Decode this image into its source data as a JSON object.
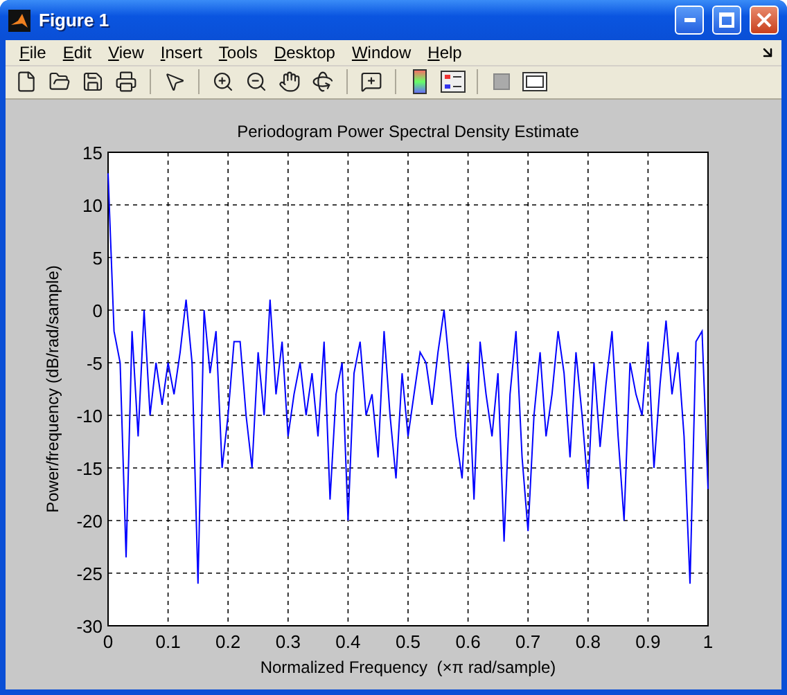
{
  "window": {
    "title": "Figure 1"
  },
  "menu": [
    "File",
    "Edit",
    "View",
    "Insert",
    "Tools",
    "Desktop",
    "Window",
    "Help"
  ],
  "toolbar": [
    {
      "kind": "new"
    },
    {
      "kind": "open"
    },
    {
      "kind": "save"
    },
    {
      "kind": "print"
    },
    {
      "kind": "sep"
    },
    {
      "kind": "pointer"
    },
    {
      "kind": "sep"
    },
    {
      "kind": "zoomin"
    },
    {
      "kind": "zoomout"
    },
    {
      "kind": "pan"
    },
    {
      "kind": "rotate"
    },
    {
      "kind": "sep"
    },
    {
      "kind": "datacursor"
    },
    {
      "kind": "sep"
    },
    {
      "kind": "colorbar"
    },
    {
      "kind": "legend"
    },
    {
      "kind": "sep"
    },
    {
      "kind": "hidetools"
    },
    {
      "kind": "showtools"
    }
  ],
  "figure": {
    "chart_data": {
      "type": "line",
      "title": "Periodogram Power Spectral Density Estimate",
      "xlabel": "Normalized Frequency  (×π rad/sample)",
      "ylabel": "Power/frequency (dB/rad/sample)",
      "grid": true,
      "xlim": [
        0,
        1
      ],
      "ylim": [
        -30,
        15
      ],
      "xticks": [
        0,
        0.1,
        0.2,
        0.3,
        0.4,
        0.5,
        0.6,
        0.7,
        0.8,
        0.9,
        1
      ],
      "yticks": [
        -30,
        -25,
        -20,
        -15,
        -10,
        -5,
        0,
        5,
        10,
        15
      ],
      "x": [
        0,
        0.01,
        0.02,
        0.03,
        0.04,
        0.05,
        0.06,
        0.07,
        0.08,
        0.09,
        0.1,
        0.11,
        0.12,
        0.13,
        0.14,
        0.15,
        0.16,
        0.17,
        0.18,
        0.19,
        0.2,
        0.21,
        0.22,
        0.23,
        0.24,
        0.25,
        0.26,
        0.27,
        0.28,
        0.29,
        0.3,
        0.31,
        0.32,
        0.33,
        0.34,
        0.35,
        0.36,
        0.37,
        0.38,
        0.39,
        0.4,
        0.41,
        0.42,
        0.43,
        0.44,
        0.45,
        0.46,
        0.47,
        0.48,
        0.49,
        0.5,
        0.51,
        0.52,
        0.53,
        0.54,
        0.55,
        0.56,
        0.57,
        0.58,
        0.59,
        0.6,
        0.61,
        0.62,
        0.63,
        0.64,
        0.65,
        0.66,
        0.67,
        0.68,
        0.69,
        0.7,
        0.71,
        0.72,
        0.73,
        0.74,
        0.75,
        0.76,
        0.77,
        0.78,
        0.79,
        0.8,
        0.81,
        0.82,
        0.83,
        0.84,
        0.85,
        0.86,
        0.87,
        0.88,
        0.89,
        0.9,
        0.91,
        0.92,
        0.93,
        0.94,
        0.95,
        0.96,
        0.97,
        0.98,
        0.99,
        1
      ],
      "series": [
        {
          "color": "#0000ff",
          "values": [
            13,
            -2,
            -5,
            -23.5,
            -2,
            -12,
            0,
            -10,
            -5,
            -9,
            -5,
            -8,
            -4,
            1,
            -5,
            -26,
            0,
            -6,
            -2,
            -15,
            -10,
            -3,
            -3,
            -10,
            -15,
            -4,
            -10,
            1,
            -8,
            -3,
            -12,
            -8,
            -5,
            -10,
            -6,
            -12,
            -3,
            -18,
            -8,
            -5,
            -20,
            -6,
            -3,
            -10,
            -8,
            -14,
            -2,
            -10,
            -16,
            -6,
            -12,
            -8,
            -4,
            -5,
            -9,
            -4,
            0,
            -6,
            -12,
            -16,
            -5,
            -18,
            -3,
            -8,
            -12,
            -6,
            -22,
            -8,
            -2,
            -14,
            -21,
            -10,
            -4,
            -12,
            -8,
            -2,
            -6,
            -14,
            -4,
            -10,
            -17,
            -5,
            -13,
            -7,
            -2,
            -12,
            -20,
            -5,
            -8,
            -10,
            -3,
            -15,
            -7,
            -1,
            -8,
            -4,
            -12,
            -26,
            -3,
            -2,
            -17
          ]
        }
      ]
    }
  }
}
